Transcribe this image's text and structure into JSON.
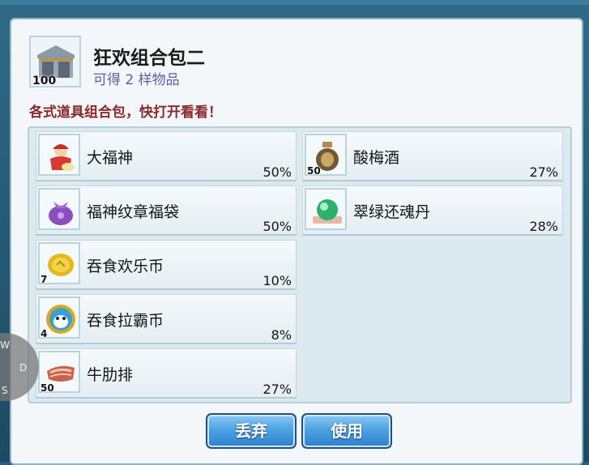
{
  "package": {
    "title": "狂欢组合包二",
    "subtitle": "可得 2 样物品",
    "description": "各式道具组合包，快打开看看！",
    "icon": "storehouse-icon",
    "quantity": "100"
  },
  "items_left": [
    {
      "name": "大福神",
      "chance": "50%",
      "qty": "",
      "icon": "fortune-god-icon"
    },
    {
      "name": "福神纹章福袋",
      "chance": "50%",
      "qty": "",
      "icon": "lucky-bag-icon"
    },
    {
      "name": "吞食欢乐币",
      "chance": "10%",
      "qty": "7",
      "icon": "gold-coin-icon"
    },
    {
      "name": "吞食拉霸币",
      "chance": "8%",
      "qty": "4",
      "icon": "slot-coin-icon"
    },
    {
      "name": "牛肋排",
      "chance": "27%",
      "qty": "50",
      "icon": "beef-rib-icon"
    }
  ],
  "items_right": [
    {
      "name": "酸梅酒",
      "chance": "27%",
      "qty": "50",
      "icon": "wine-jar-icon"
    },
    {
      "name": "翠绿还魂丹",
      "chance": "28%",
      "qty": "",
      "icon": "jade-orb-icon"
    }
  ],
  "buttons": {
    "discard": "丢弃",
    "use": "使用"
  },
  "side_orb": {
    "top": "W",
    "mid": "D",
    "bottom": "S"
  }
}
